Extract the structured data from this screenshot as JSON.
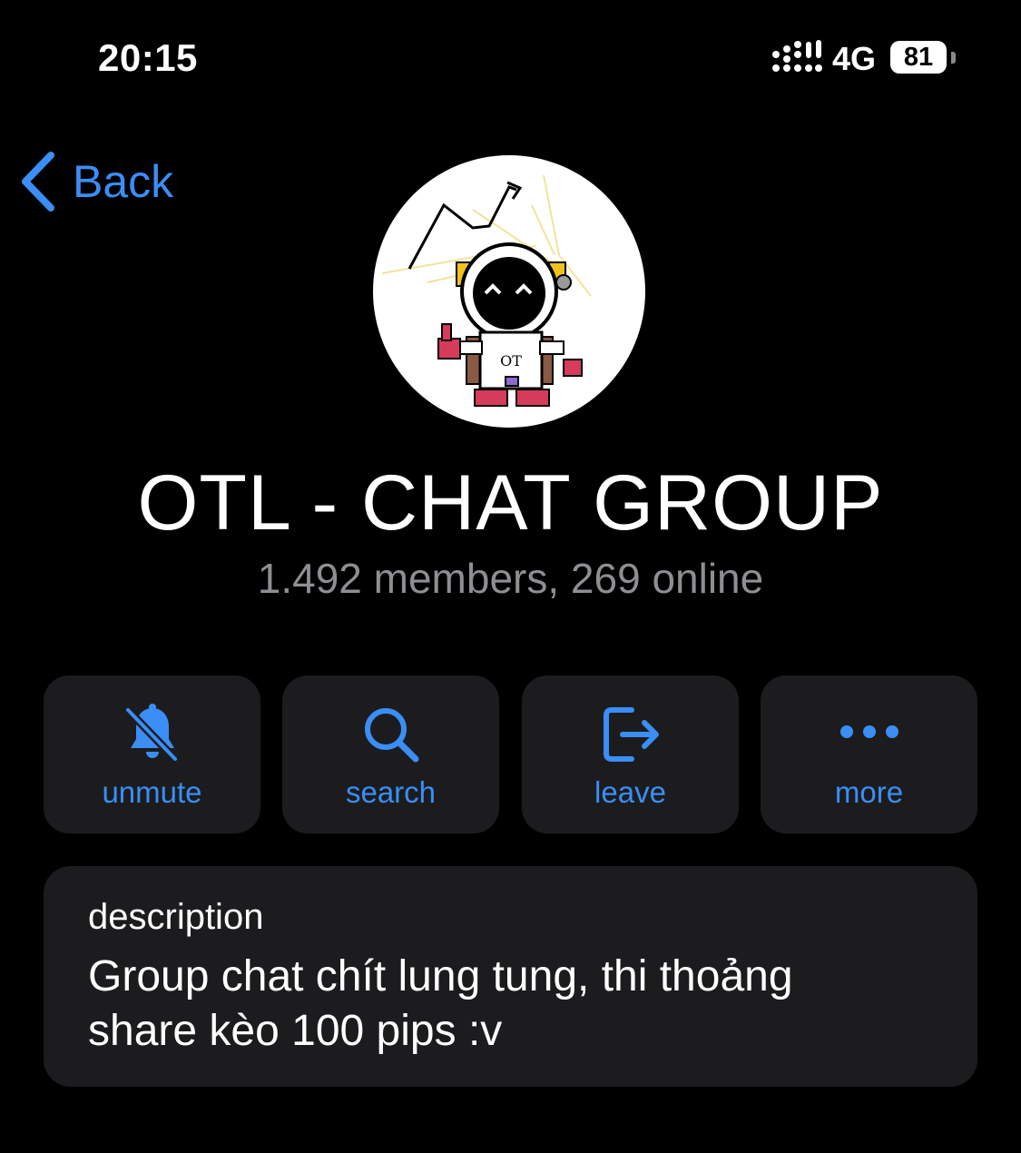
{
  "status_bar": {
    "time": "20:15",
    "network": "4G",
    "battery": "81",
    "icons": {
      "signal": "cellular-signal-icon"
    }
  },
  "nav": {
    "back_label": "Back",
    "back_icon": "chevron-left-icon",
    "accent_color": "#3a8ef5"
  },
  "group": {
    "name": "OTL - CHAT GROUP",
    "meta": "1.492 members, 269 online",
    "avatar_text": "OT"
  },
  "actions": [
    {
      "label": "unmute",
      "icon": "bell-slash-icon"
    },
    {
      "label": "search",
      "icon": "search-icon"
    },
    {
      "label": "leave",
      "icon": "leave-icon"
    },
    {
      "label": "more",
      "icon": "more-icon"
    }
  ],
  "description": {
    "title": "description",
    "text": "Group chat chít lung tung, thi thoảng share kèo 100 pips :v"
  },
  "colors": {
    "background": "#000000",
    "card": "#1c1c1e",
    "secondary_text": "#8e8e93"
  }
}
